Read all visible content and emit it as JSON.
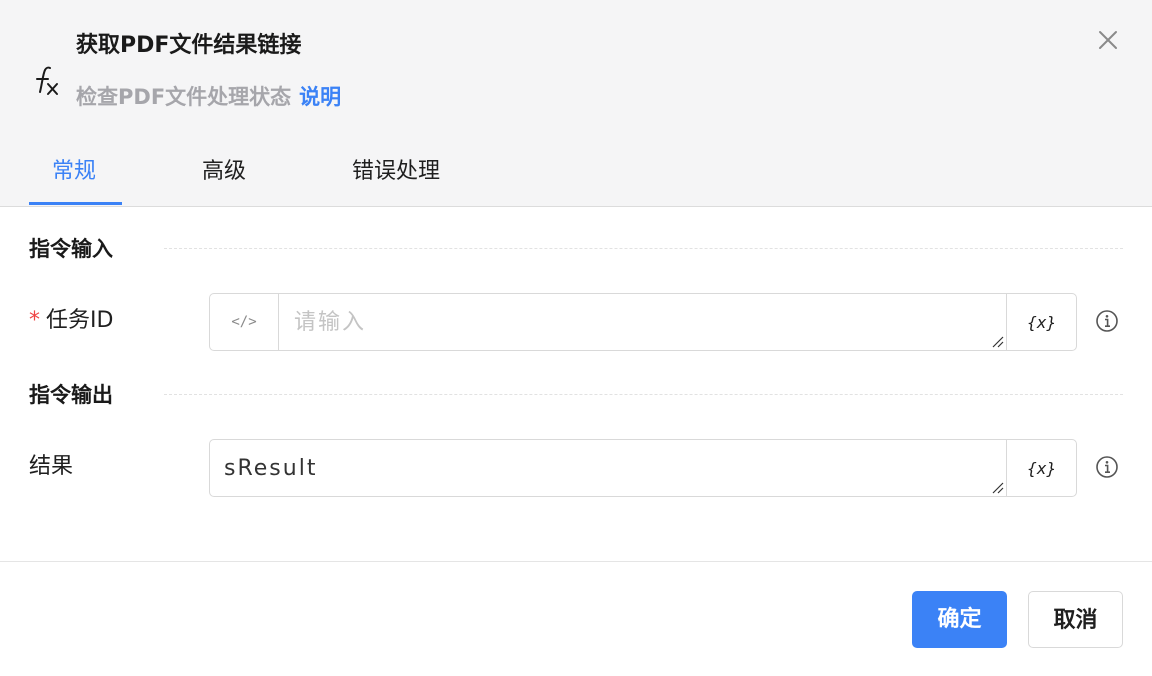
{
  "header": {
    "icon": "function-fx-icon",
    "title": "获取PDF文件结果链接",
    "subtitle": "检查PDF文件处理状态",
    "help_link": "说明",
    "close_icon": "close-icon"
  },
  "tabs": [
    {
      "label": "常规",
      "active": true
    },
    {
      "label": "高级",
      "active": false
    },
    {
      "label": "错误处理",
      "active": false
    }
  ],
  "sections": {
    "input": {
      "title": "指令输入",
      "fields": [
        {
          "required_mark": "*",
          "label": "任务ID",
          "prefix": "</>",
          "placeholder": "请输入",
          "value": "",
          "var_button": "{x}"
        }
      ]
    },
    "output": {
      "title": "指令输出",
      "fields": [
        {
          "label": "结果",
          "value": "sResult",
          "var_button": "{x}"
        }
      ]
    }
  },
  "footer": {
    "confirm_label": "确定",
    "cancel_label": "取消"
  },
  "colors": {
    "accent": "#3b82f6",
    "required": "#ef4444",
    "header_bg": "#f5f5f6"
  }
}
